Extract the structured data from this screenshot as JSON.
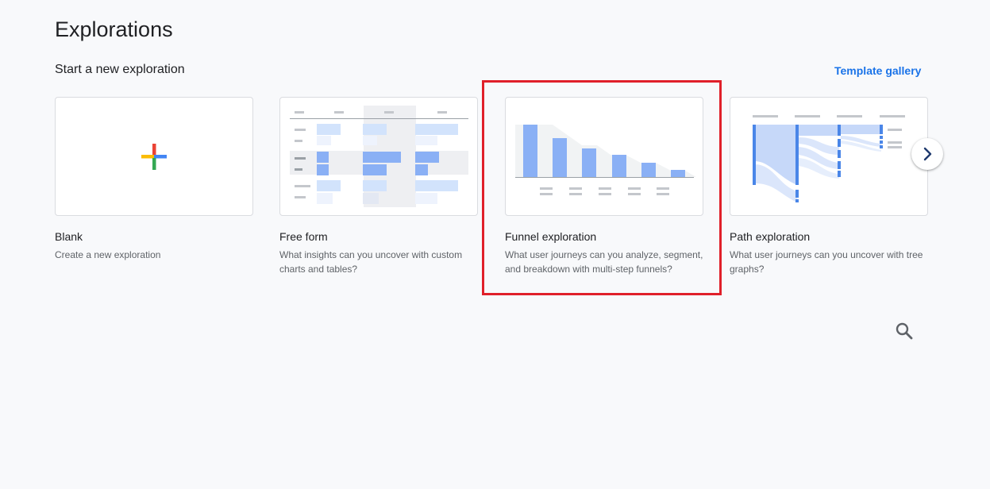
{
  "header": {
    "title": "Explorations",
    "section_title": "Start a new exploration",
    "template_gallery_label": "Template gallery"
  },
  "cards": [
    {
      "title": "Blank",
      "description": "Create a new exploration",
      "icon": "plus-icon"
    },
    {
      "title": "Free form",
      "description": "What insights can you uncover with custom charts and tables?",
      "icon": "free-form-thumbnail"
    },
    {
      "title": "Funnel exploration",
      "description": "What user journeys can you analyze, segment, and breakdown with multi-step funnels?",
      "icon": "funnel-thumbnail"
    },
    {
      "title": "Path exploration",
      "description": "What user journeys can you uncover with tree graphs?",
      "icon": "path-thumbnail"
    }
  ],
  "highlighted_card": "Funnel exploration",
  "controls": {
    "next_icon": "chevron-right-icon",
    "search_icon": "search-icon"
  },
  "colors": {
    "accent": "#1a73e8",
    "highlight_border": "#e0202a",
    "bar_blue": "#8ab0f5",
    "light_blue": "#d2e3fc"
  }
}
